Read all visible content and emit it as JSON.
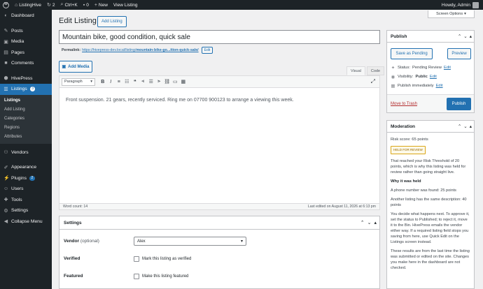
{
  "adminbar": {
    "site": "ListingHive",
    "updates": "2",
    "shortcut": "Ctrl+K",
    "comments": "0",
    "new_label": "New",
    "view_listing": "View Listing",
    "user": "Howdy, Admin"
  },
  "sidebar": {
    "items": [
      {
        "label": "Dashboard",
        "icon": "dashboard-icon"
      },
      {
        "label": "Posts",
        "icon": "pin-icon"
      },
      {
        "label": "Media",
        "icon": "media-icon"
      },
      {
        "label": "Pages",
        "icon": "page-icon"
      },
      {
        "label": "Comments",
        "icon": "comment-icon"
      },
      {
        "label": "HivePress",
        "icon": "hivepress-icon"
      },
      {
        "label": "Listings",
        "icon": "listings-icon",
        "badge": "3"
      },
      {
        "label": "Vendors",
        "icon": "vendors-icon"
      },
      {
        "label": "Appearance",
        "icon": "brush-icon"
      },
      {
        "label": "Plugins",
        "icon": "plug-icon",
        "badge": "2"
      },
      {
        "label": "Users",
        "icon": "user-icon"
      },
      {
        "label": "Tools",
        "icon": "wrench-icon"
      },
      {
        "label": "Settings",
        "icon": "settings-icon"
      },
      {
        "label": "Collapse Menu",
        "icon": "collapse-icon"
      }
    ],
    "submenu": [
      "Listings",
      "Add Listing",
      "Categories",
      "Regions",
      "Attributes"
    ]
  },
  "header": {
    "title": "Edit Listing",
    "add_button": "Add Listing",
    "screen_options": "Screen Options"
  },
  "post": {
    "title": "Mountain bike, good condition, quick sale",
    "permalink_label": "Permalink:",
    "permalink_base": "https://hivepress-dev.local/listing/",
    "permalink_slug": "mountain-bike-go...ition-quick-sale/",
    "permalink_edit": "Edit"
  },
  "editor": {
    "add_media": "Add Media",
    "tab_visual": "Visual",
    "tab_code": "Code",
    "format": "Paragraph",
    "content": "Front suspension. 21 gears, recently serviced. Ring me on 07700 900123 to arrange a viewing this week.",
    "word_count": "Word count: 14",
    "last_edited": "Last edited on August 11, 2026 at 6:13 pm"
  },
  "settings": {
    "title": "Settings",
    "vendor_label": "Vendor",
    "vendor_optional": "(optional)",
    "vendor_value": "Alex",
    "verified_label": "Verified",
    "verified_cb": "Mark this listing as verified",
    "featured_label": "Featured",
    "featured_cb": "Make this listing featured"
  },
  "publish": {
    "title": "Publish",
    "save_pending": "Save as Pending",
    "preview": "Preview",
    "status_label": "Status:",
    "status_value": "Pending Review",
    "visibility_label": "Visibility:",
    "visibility_value": "Public",
    "publish_label": "Publish immediately",
    "edit": "Edit",
    "trash": "Move to Trash",
    "publish_btn": "Publish"
  },
  "moderation": {
    "title": "Moderation",
    "risk": "Risk score: 65 points",
    "held_badge": "HELD FOR REVIEW",
    "p1": "That reached your Risk Threshold of 20 points, which is why this listing was held for review rather than going straight live.",
    "why_heading": "Why it was held",
    "reason1": "A phone number was found: 25 points",
    "reason2": "Another listing has the same description: 40 points",
    "p2": "You decide what happens next. To approve it, set the status to Published; to reject it, move it to the Bin. HivePress emails the vendor either way. If a required listing field stops you saving from here, use Quick Edit on the Listings screen instead.",
    "p3": "These results are from the last time the listing was submitted or edited on the site. Changes you make here in the dashboard are not checked."
  }
}
